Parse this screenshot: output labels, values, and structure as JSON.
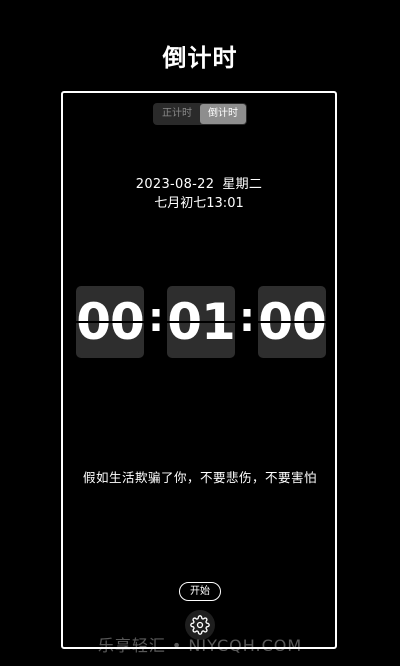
{
  "header": {
    "title": "倒计时"
  },
  "mode_toggle": {
    "tabs": [
      {
        "label": "正计时",
        "active": false
      },
      {
        "label": "倒计时",
        "active": true
      }
    ]
  },
  "datetime": {
    "date": "2023-08-22",
    "weekday": "星期二",
    "lunar_date": "七月初七",
    "time": "13:01"
  },
  "timer": {
    "hours": "00",
    "minutes": "01",
    "seconds": "00",
    "separator": ":"
  },
  "quote": {
    "text": "假如生活欺骗了你，不要悲伤，不要害怕"
  },
  "controls": {
    "start_label": "开始",
    "settings_icon": "gear-icon"
  },
  "watermark": {
    "text": "乐享轻汇 • NIYCQH.COM"
  },
  "colors": {
    "background": "#000000",
    "card": "#2e2e2e",
    "toggle_active": "#8e8e8e",
    "toggle_bg": "#2a2a2a",
    "text": "#ffffff"
  }
}
